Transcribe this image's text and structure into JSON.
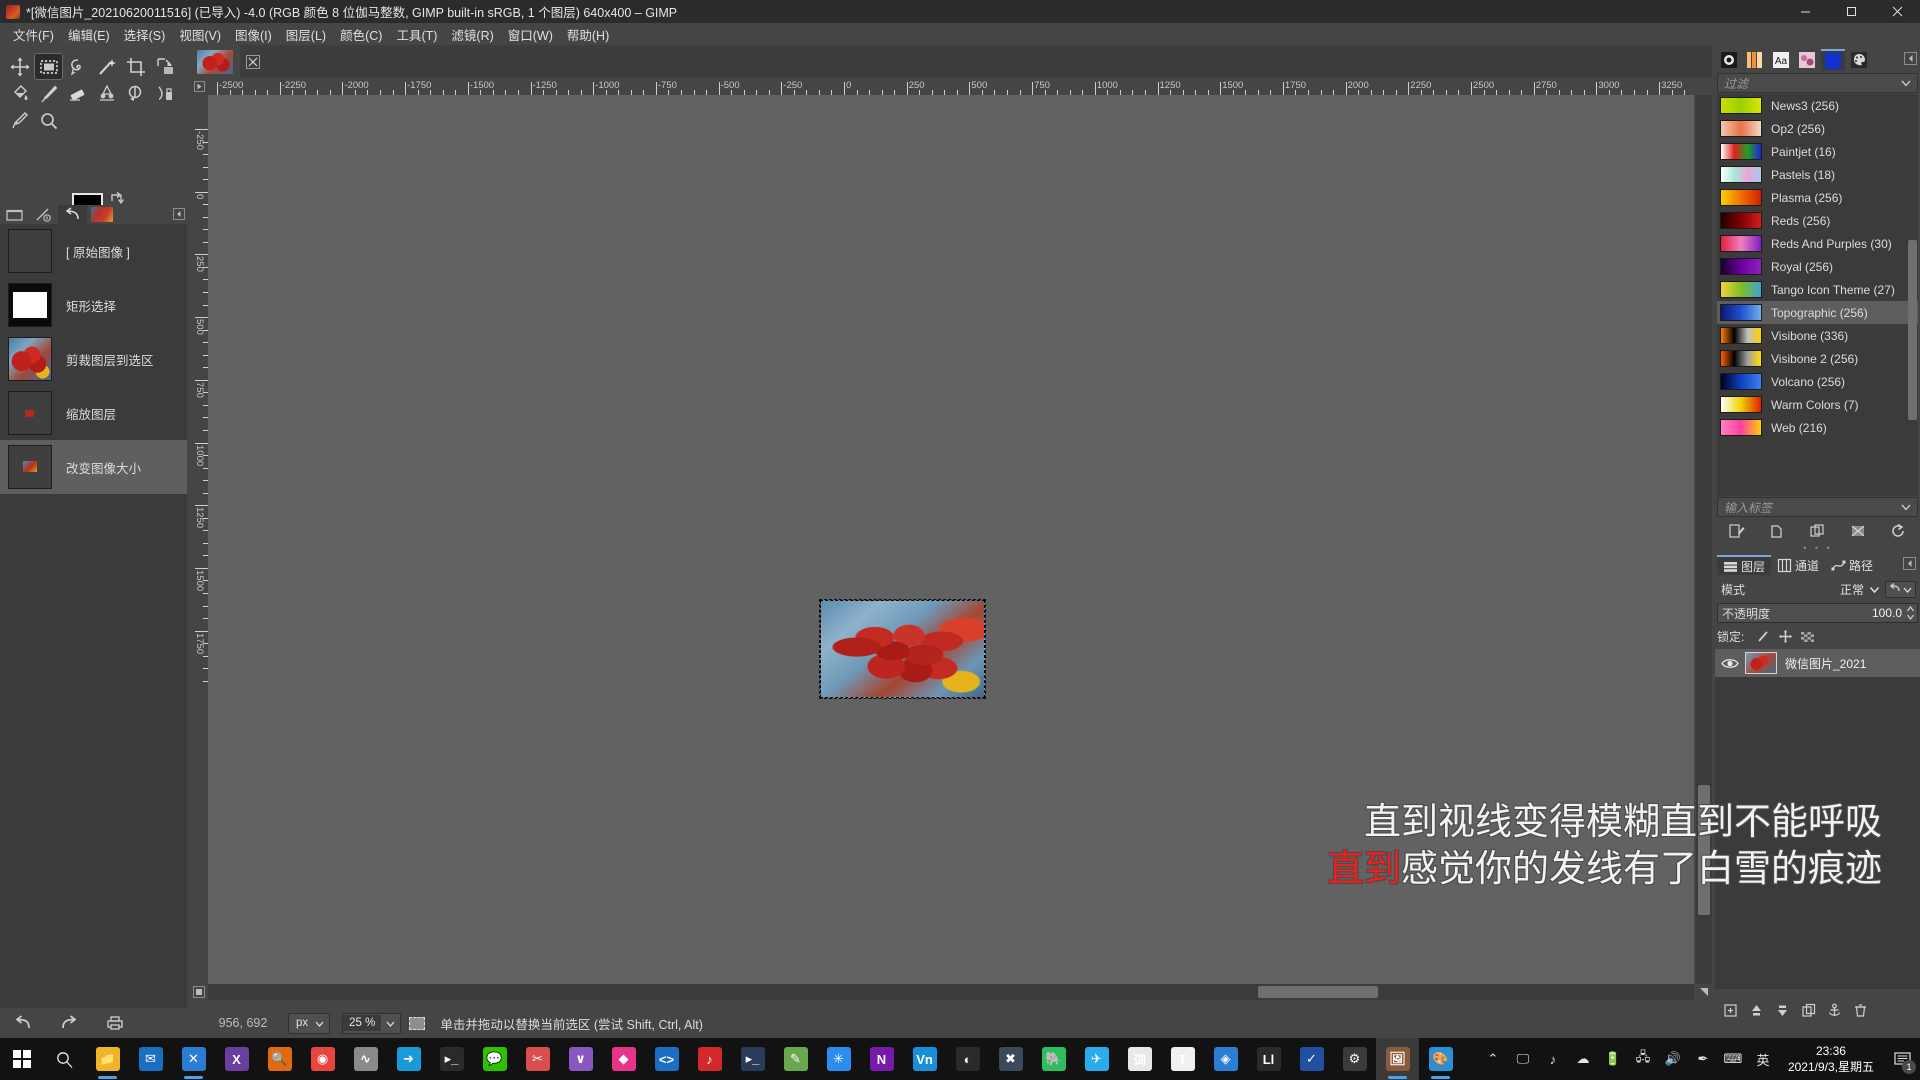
{
  "window": {
    "title": "*[微信图片_20210620011516] (已导入) -4.0 (RGB 颜色 8 位伽马整数, GIMP built-in sRGB, 1 个图层) 640x400 – GIMP",
    "minimize": "–",
    "maximize": "□",
    "close": "✕"
  },
  "menubar": {
    "items": [
      {
        "label": "文件(F)",
        "name": "menu-file"
      },
      {
        "label": "编辑(E)",
        "name": "menu-edit"
      },
      {
        "label": "选择(S)",
        "name": "menu-select"
      },
      {
        "label": "视图(V)",
        "name": "menu-view"
      },
      {
        "label": "图像(I)",
        "name": "menu-image"
      },
      {
        "label": "图层(L)",
        "name": "menu-layer"
      },
      {
        "label": "颜色(C)",
        "name": "menu-colors"
      },
      {
        "label": "工具(T)",
        "name": "menu-tools"
      },
      {
        "label": "滤镜(R)",
        "name": "menu-filters"
      },
      {
        "label": "窗口(W)",
        "name": "menu-windows"
      },
      {
        "label": "帮助(H)",
        "name": "menu-help"
      }
    ]
  },
  "toolbox": {
    "tools": [
      {
        "name": "move-tool",
        "icon": "move-icon",
        "active": false
      },
      {
        "name": "rectangle-select-tool",
        "icon": "rectangle-select-icon",
        "active": true
      },
      {
        "name": "free-select-tool",
        "icon": "lasso-icon",
        "active": false
      },
      {
        "name": "fuzzy-select-tool",
        "icon": "magic-wand-icon",
        "active": false
      },
      {
        "name": "crop-tool",
        "icon": "crop-icon",
        "active": false
      },
      {
        "name": "transform-tool",
        "icon": "transform-icon",
        "active": false
      },
      {
        "name": "bucket-fill-tool",
        "icon": "bucket-fill-icon",
        "active": false
      },
      {
        "name": "paintbrush-tool",
        "icon": "paintbrush-icon",
        "active": false
      },
      {
        "name": "eraser-tool",
        "icon": "eraser-icon",
        "active": false
      },
      {
        "name": "smudge-tool",
        "icon": "smudge-icon",
        "active": false
      },
      {
        "name": "clone-tool",
        "icon": "clone-icon",
        "active": false
      },
      {
        "name": "ink-tool",
        "icon": "ink-icon",
        "active": false
      },
      {
        "name": "color-picker-tool",
        "icon": "eyedropper-icon",
        "active": false
      },
      {
        "name": "zoom-tool",
        "icon": "magnifier-icon",
        "active": false
      }
    ],
    "foreground_color": "#000000",
    "background_color": "#ffffff"
  },
  "history": {
    "tabs": [
      "tool-options-tab",
      "device-status-tab",
      "undo-history-tab",
      "images-tab"
    ],
    "active_tab_index": 2,
    "items": [
      {
        "label": "[ 原始图像 ]",
        "thumb": "empty",
        "selected": false
      },
      {
        "label": "矩形选择",
        "thumb": "rect",
        "selected": false
      },
      {
        "label": "剪裁图层到选区",
        "thumb": "photo",
        "selected": false
      },
      {
        "label": "缩放图层",
        "thumb": "small",
        "selected": false
      },
      {
        "label": "改变图像大小",
        "thumb": "tiny",
        "selected": true
      }
    ]
  },
  "canvas": {
    "ruler_h_labels": [
      "-2500",
      "-2250",
      "-2000",
      "-1750",
      "-1500",
      "-1250",
      "-1000",
      "-750",
      "-500",
      "-250",
      "0",
      "250",
      "500",
      "750",
      "1000",
      "1250",
      "1500",
      "1750",
      "2000",
      "2250",
      "2500",
      "2750",
      "3000",
      "3250"
    ],
    "ruler_v_labels": [
      "-250",
      "0",
      "250",
      "500",
      "750",
      "1000",
      "1250",
      "1500",
      "1750"
    ],
    "image_tab_title": "微信图片_20210620011516"
  },
  "statusbar": {
    "position": "956, 692",
    "unit": "px",
    "zoom": "25 %",
    "message": "单击并拖动以替换当前选区  (尝试 Shift, Ctrl, Alt)"
  },
  "left_bottom": {
    "undo": "undo-icon",
    "redo": "redo-icon",
    "print": "print-icon"
  },
  "right_dock": {
    "tabs": [
      {
        "name": "brushes-tab",
        "icon": "brush-dot-icon",
        "active": false
      },
      {
        "name": "gradients-tab-alt",
        "icon": "gradient-bars-icon",
        "active": false
      },
      {
        "name": "fonts-tab",
        "icon": "font-aa-icon",
        "active": false
      },
      {
        "name": "patterns-tab",
        "icon": "pattern-icon",
        "active": false
      },
      {
        "name": "gradients-tab",
        "icon": "blue-gradient-icon",
        "active": true
      },
      {
        "name": "palettes-tab",
        "icon": "palette-icon",
        "active": false
      }
    ],
    "filter_placeholder": "过滤",
    "tag_placeholder": "输入标签",
    "gradients": [
      {
        "label": "News3 (256)",
        "colors": [
          "#c8e000",
          "#9ad000",
          "#d8e800"
        ],
        "selected": false
      },
      {
        "label": "Op2 (256)",
        "colors": [
          "#f0c8a8",
          "#e8714a",
          "#f4d8c0"
        ],
        "selected": false
      },
      {
        "label": "Paintjet (16)",
        "colors": [
          "#ffffff",
          "#e02020",
          "#20a020",
          "#2020e0"
        ],
        "selected": false
      },
      {
        "label": "Pastels (18)",
        "colors": [
          "#ffffff",
          "#a8e8d8",
          "#e8a8d8",
          "#a8c8f0"
        ],
        "selected": false
      },
      {
        "label": "Plasma (256)",
        "colors": [
          "#f8d000",
          "#f07000",
          "#d02000"
        ],
        "selected": false
      },
      {
        "label": "Reds (256)",
        "colors": [
          "#200000",
          "#800000",
          "#d02020"
        ],
        "selected": false
      },
      {
        "label": "Reds And Purples (30)",
        "colors": [
          "#e02040",
          "#f080c0",
          "#8020c0"
        ],
        "selected": false
      },
      {
        "label": "Royal (256)",
        "colors": [
          "#1a0030",
          "#6a00a0",
          "#9020c0"
        ],
        "selected": false
      },
      {
        "label": "Tango Icon Theme (27)",
        "colors": [
          "#f0d040",
          "#80c020",
          "#40a0d0"
        ],
        "selected": false
      },
      {
        "label": "Topographic (256)",
        "colors": [
          "#0a1a70",
          "#2050d0",
          "#70b0f0"
        ],
        "selected": true
      },
      {
        "label": "Visibone (336)",
        "colors": [
          "#ff8000",
          "#000000",
          "#c0c0c0",
          "#ffd000"
        ],
        "selected": false
      },
      {
        "label": "Visibone 2 (256)",
        "colors": [
          "#ff6000",
          "#000000",
          "#a0a0a0",
          "#ffe000"
        ],
        "selected": false
      },
      {
        "label": "Volcano (256)",
        "colors": [
          "#000020",
          "#1040c0",
          "#4080f0"
        ],
        "selected": false
      },
      {
        "label": "Warm Colors (7)",
        "colors": [
          "#ffffff",
          "#f0d000",
          "#e02000"
        ],
        "selected": false
      },
      {
        "label": "Web (216)",
        "colors": [
          "#ff80c0",
          "#ff40a0",
          "#ffd000"
        ],
        "selected": false
      }
    ],
    "buttons": [
      {
        "name": "edit-gradient-button",
        "icon": "edit-icon"
      },
      {
        "name": "new-gradient-button",
        "icon": "new-icon"
      },
      {
        "name": "duplicate-gradient-button",
        "icon": "duplicate-icon"
      },
      {
        "name": "delete-gradient-button",
        "icon": "delete-icon"
      },
      {
        "name": "refresh-gradients-button",
        "icon": "refresh-icon"
      }
    ]
  },
  "layers_panel": {
    "tabs": [
      {
        "label": "图层",
        "name": "tab-layers",
        "active": true
      },
      {
        "label": "通道",
        "name": "tab-channels",
        "active": false
      },
      {
        "label": "路径",
        "name": "tab-paths",
        "active": false
      }
    ],
    "mode_label": "模式",
    "mode_value": "正常",
    "opacity_label": "不透明度",
    "opacity_value": "100.0",
    "lock_label": "锁定:",
    "lock_buttons": [
      {
        "name": "lock-pixels-button",
        "icon": "brush-stroke-icon"
      },
      {
        "name": "lock-position-button",
        "icon": "move-cross-icon"
      },
      {
        "name": "lock-alpha-button",
        "icon": "checkerboard-icon"
      }
    ],
    "layers": [
      {
        "name": "微信图片_2021",
        "visible": true,
        "selected": true
      }
    ],
    "bottom_buttons": [
      {
        "name": "new-layer-button",
        "icon": "new-layer-icon"
      },
      {
        "name": "raise-layer-button",
        "icon": "arrow-up-icon"
      },
      {
        "name": "lower-layer-button",
        "icon": "arrow-down-icon"
      },
      {
        "name": "duplicate-layer-button",
        "icon": "duplicate-layer-icon"
      },
      {
        "name": "anchor-layer-button",
        "icon": "anchor-icon"
      },
      {
        "name": "delete-layer-button",
        "icon": "trash-icon"
      }
    ]
  },
  "lyrics": {
    "line1": "直到视线变得模糊直到不能呼吸",
    "line2_highlight": "直到",
    "line2_rest": "感觉你的发线有了白雪的痕迹",
    "highlight_color": "#ee1f1f"
  },
  "taskbar": {
    "start": "windows-logo-icon",
    "search": "search-icon",
    "items": [
      {
        "name": "file-explorer-icon",
        "glyph": "📁",
        "bg": "#f0b429",
        "running": true
      },
      {
        "name": "mail-icon",
        "glyph": "✉",
        "bg": "#1a6fc4",
        "running": false
      },
      {
        "name": "vscode-icon",
        "glyph": "✕",
        "bg": "#2b7cd3",
        "running": true
      },
      {
        "name": "xmind-icon",
        "glyph": "X",
        "bg": "#6b3fa0",
        "running": false
      },
      {
        "name": "everything-search-icon",
        "glyph": "🔍",
        "bg": "#e06a10",
        "running": false
      },
      {
        "name": "chrome-icon",
        "glyph": "◉",
        "bg": "#e8453c",
        "running": false
      },
      {
        "name": "matlab-icon",
        "glyph": "∿",
        "bg": "#8a8a8a",
        "running": false
      },
      {
        "name": "export-icon",
        "glyph": "➜",
        "bg": "#1a9ad9",
        "running": false
      },
      {
        "name": "terminal-icon",
        "glyph": "▸_",
        "bg": "#2a2a2a",
        "running": false
      },
      {
        "name": "wechat-icon",
        "glyph": "💬",
        "bg": "#2dc100",
        "running": false
      },
      {
        "name": "snipaste-icon",
        "glyph": "✂",
        "bg": "#d94f4f",
        "running": false
      },
      {
        "name": "visual-studio-icon",
        "glyph": "∨",
        "bg": "#8a56c0",
        "running": false
      },
      {
        "name": "unity-icon",
        "glyph": "◆",
        "bg": "#e8338a",
        "running": false
      },
      {
        "name": "code-icon",
        "glyph": "<>",
        "bg": "#1a6fc4",
        "running": false
      },
      {
        "name": "netease-music-icon",
        "glyph": "♪",
        "bg": "#d3282b",
        "running": false
      },
      {
        "name": "powershell-icon",
        "glyph": "▸_",
        "bg": "#2a3a5a",
        "running": false
      },
      {
        "name": "notepad-icon",
        "glyph": "✎",
        "bg": "#6aa84f",
        "running": false
      },
      {
        "name": "star-note-icon",
        "glyph": "✳",
        "bg": "#2d8cf0",
        "running": false
      },
      {
        "name": "onenote-icon",
        "glyph": "N",
        "bg": "#7719aa",
        "running": false
      },
      {
        "name": "vnc-icon",
        "glyph": "Vn",
        "bg": "#1a8fd9",
        "running": false
      },
      {
        "name": "cad-icon",
        "glyph": "◐",
        "bg": "#2a2a2a",
        "running": false
      },
      {
        "name": "proteus-icon",
        "glyph": "✖",
        "bg": "#3a4a5a",
        "running": false
      },
      {
        "name": "evernote-icon",
        "glyph": "🐘",
        "bg": "#2dbe60",
        "running": false
      },
      {
        "name": "telegram-icon",
        "glyph": "✈",
        "bg": "#2aabee",
        "running": false
      },
      {
        "name": "dict-icon",
        "glyph": "词",
        "bg": "#e8e8e8",
        "running": false
      },
      {
        "name": "typora-icon",
        "glyph": "T",
        "bg": "#f0f0f0",
        "running": false
      },
      {
        "name": "blue-app-icon",
        "glyph": "◈",
        "bg": "#2a7fd4",
        "running": false
      },
      {
        "name": "li-app-icon",
        "glyph": "Ll",
        "bg": "#2a2a2a",
        "running": false
      },
      {
        "name": "foxit-icon",
        "glyph": "✓",
        "bg": "#2050a0",
        "running": false
      },
      {
        "name": "settings-icon",
        "glyph": "⚙",
        "bg": "#3a3a3a",
        "running": false
      },
      {
        "name": "gimp-icon",
        "glyph": "🖼",
        "bg": "#8a5a3a",
        "running": true,
        "active": true
      },
      {
        "name": "paint-icon",
        "glyph": "🎨",
        "bg": "#2a8fd4",
        "running": true
      }
    ],
    "tray": [
      {
        "name": "show-hidden-icons",
        "glyph": "⌃"
      },
      {
        "name": "screen-share-icon",
        "glyph": "🖵"
      },
      {
        "name": "netease-tray-icon",
        "glyph": "♪"
      },
      {
        "name": "onedrive-icon",
        "glyph": "☁"
      },
      {
        "name": "battery-icon",
        "glyph": "🔋"
      },
      {
        "name": "network-icon",
        "glyph": "🖧"
      },
      {
        "name": "volume-icon",
        "glyph": "🔊"
      },
      {
        "name": "pen-icon",
        "glyph": "✒"
      },
      {
        "name": "keyboard-icon",
        "glyph": "⌨"
      },
      {
        "name": "ime-indicator",
        "glyph": "英"
      }
    ],
    "clock_time": "23:36",
    "clock_date": "2021/9/3,星期五",
    "notification_count": "1"
  }
}
